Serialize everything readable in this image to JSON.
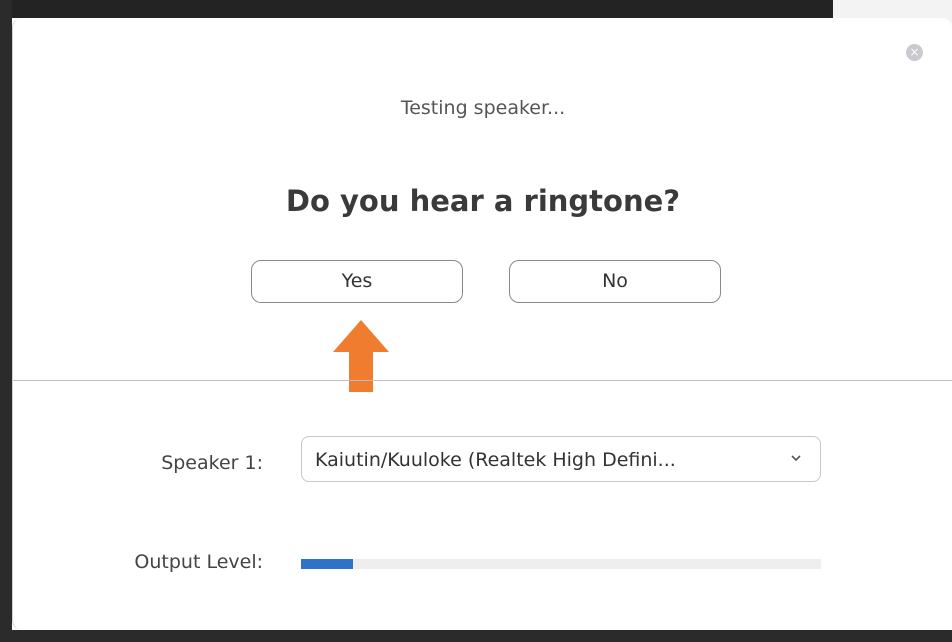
{
  "dialog": {
    "close_glyph": "×",
    "subtitle": "Testing speaker...",
    "question": "Do you hear a ringtone?",
    "yes_label": "Yes",
    "no_label": "No"
  },
  "speaker": {
    "label": "Speaker 1:",
    "selected": "Kaiutin/Kuuloke (Realtek High Defini..."
  },
  "output": {
    "label": "Output Level:",
    "level_fraction": 0.1
  },
  "icons": {
    "close": "close-icon",
    "arrow": "arrow-up-icon",
    "chevron": "chevron-down-icon"
  },
  "colors": {
    "arrow": "#f07c30",
    "level_fill": "#2d73c9",
    "level_track": "#eeeeee",
    "close_bg": "#c9c9cf"
  }
}
